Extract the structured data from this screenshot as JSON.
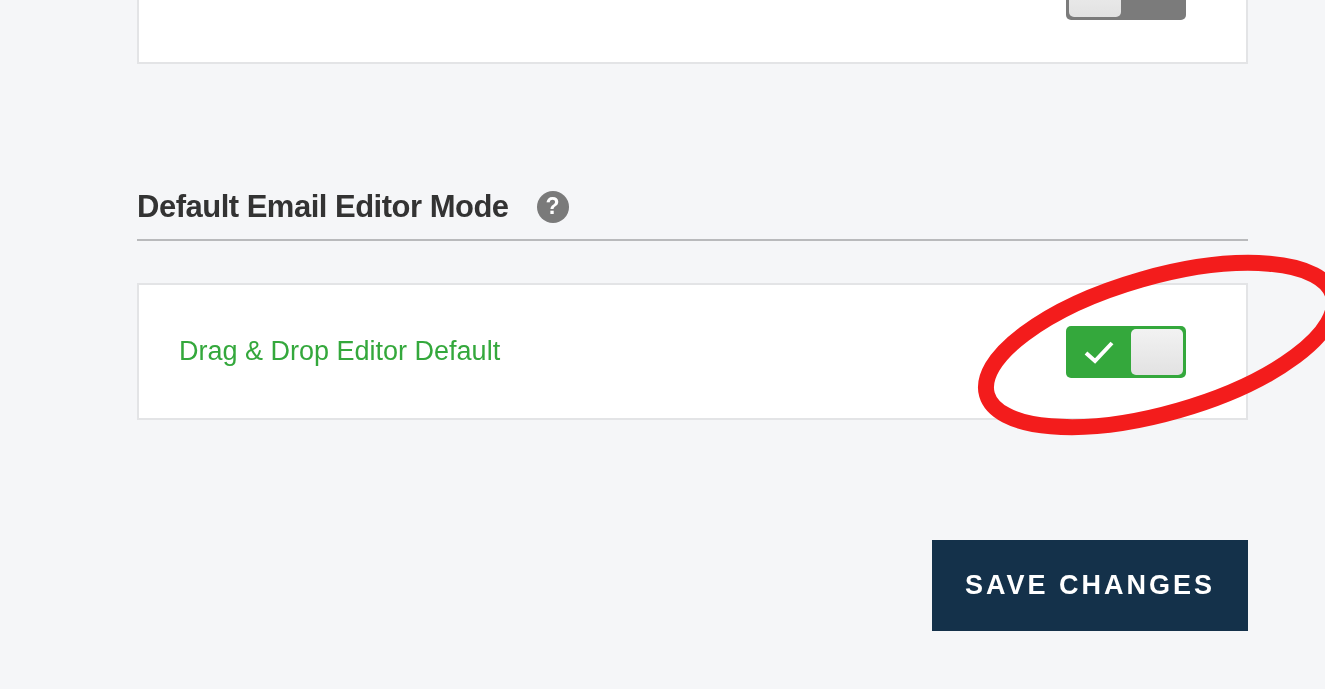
{
  "top_setting": {
    "on": false
  },
  "section": {
    "title": "Default Email Editor Mode",
    "help_icon": "?"
  },
  "settings": [
    {
      "label": "Drag & Drop Editor Default",
      "on": true,
      "highlighted": true
    }
  ],
  "save_button": "SAVE CHANGES"
}
